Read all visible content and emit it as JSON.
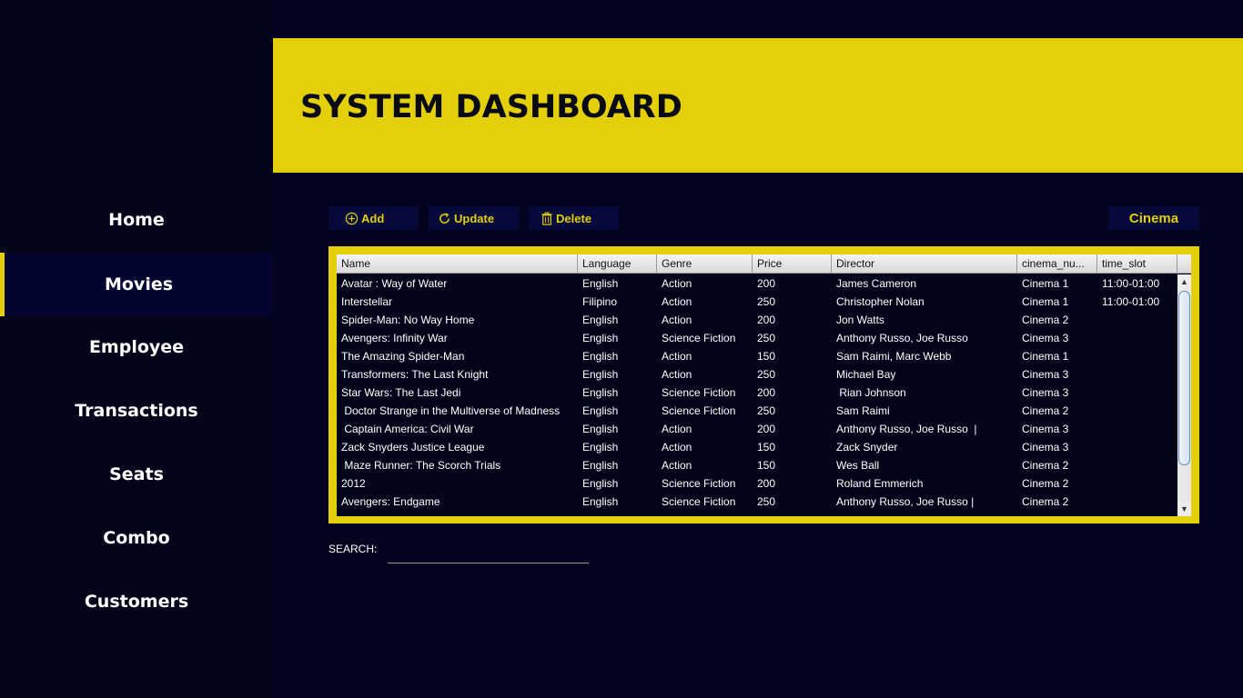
{
  "sidebar": {
    "items": [
      {
        "label": "Home"
      },
      {
        "label": "Movies"
      },
      {
        "label": "Employee"
      },
      {
        "label": "Transactions"
      },
      {
        "label": "Seats"
      },
      {
        "label": "Combo"
      },
      {
        "label": "Customers"
      }
    ],
    "active": "Movies"
  },
  "header": {
    "title": "SYSTEM DASHBOARD"
  },
  "toolbar": {
    "add_label": "Add",
    "update_label": "Update",
    "delete_label": "Delete",
    "cinema_label": "Cinema"
  },
  "table": {
    "columns": [
      "Name",
      "Language",
      "Genre",
      "Price",
      "Director",
      "cinema_nu...",
      "time_slot"
    ],
    "rows": [
      [
        "Avatar : Way of Water",
        "English",
        "Action",
        "200",
        "James Cameron",
        "Cinema 1",
        "11:00-01:00"
      ],
      [
        "Interstellar",
        "Filipino",
        "Action",
        "250",
        "Christopher Nolan",
        "Cinema 1",
        "11:00-01:00"
      ],
      [
        "Spider-Man: No Way Home",
        "English",
        "Action",
        "200",
        "Jon Watts",
        "Cinema 2",
        ""
      ],
      [
        "Avengers: Infinity War",
        "English",
        "Science Fiction",
        "250",
        "Anthony Russo, Joe Russo",
        "Cinema 3",
        ""
      ],
      [
        "The Amazing Spider-Man",
        "English",
        "Action",
        "150",
        "Sam Raimi, Marc Webb",
        "Cinema 1",
        ""
      ],
      [
        "Transformers: The Last Knight",
        "English",
        "Action",
        "250",
        "Michael Bay",
        "Cinema 3",
        ""
      ],
      [
        "Star Wars: The Last Jedi",
        "English",
        "Science Fiction",
        "200",
        " Rian Johnson",
        "Cinema 3",
        ""
      ],
      [
        " Doctor Strange in the Multiverse of Madness",
        "English",
        "Science Fiction",
        "250",
        "Sam Raimi",
        "Cinema 2",
        ""
      ],
      [
        " Captain America: Civil War",
        "English",
        "Action",
        "200",
        "Anthony Russo, Joe Russo  |",
        "Cinema 3",
        ""
      ],
      [
        "Zack Snyders Justice League",
        "English",
        "Action",
        "150",
        "Zack Snyder",
        "Cinema 3",
        ""
      ],
      [
        " Maze Runner: The Scorch Trials",
        "English",
        "Action",
        "150",
        "Wes Ball",
        "Cinema 2",
        ""
      ],
      [
        "2012",
        "English",
        "Science Fiction",
        "200",
        "Roland Emmerich",
        "Cinema 2",
        ""
      ],
      [
        "Avengers: Endgame",
        "English",
        "Science Fiction",
        "250",
        "Anthony Russo, Joe Russo |",
        "Cinema 2",
        ""
      ]
    ]
  },
  "search": {
    "label": "SEARCH:",
    "value": ""
  },
  "colors": {
    "accent": "#e3cf0a",
    "background": "#03031f",
    "sidebar": "#03041a",
    "button_bg": "#07093a"
  },
  "icons": {
    "add": "plus-circle-icon",
    "update": "refresh-icon",
    "delete": "trash-icon"
  }
}
